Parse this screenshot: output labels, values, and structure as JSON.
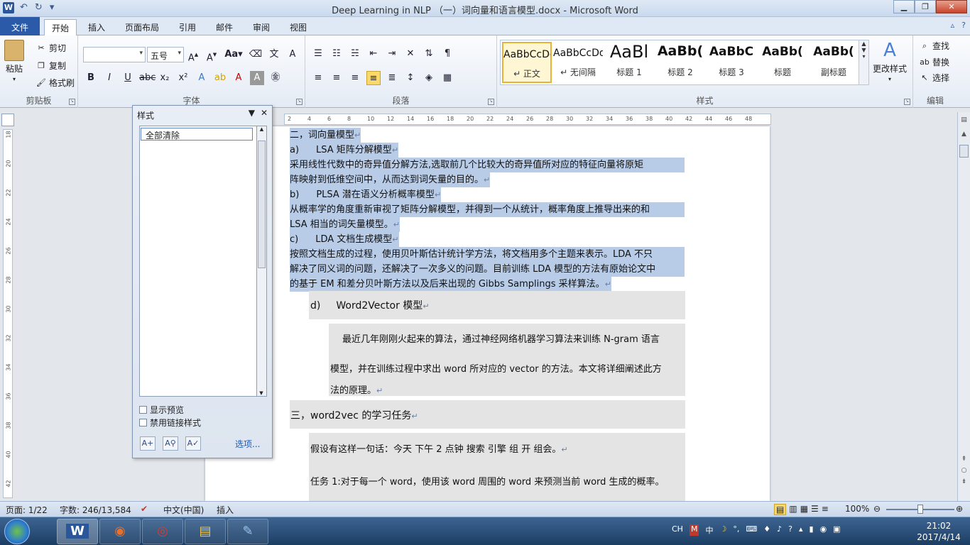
{
  "window": {
    "title": "Deep Learning in NLP （一）词向量和语言模型.docx - Microsoft Word",
    "app_badge": "W",
    "qat_icons": [
      "undo-icon",
      "redo-icon",
      "customize-icon"
    ]
  },
  "tabs": {
    "file": "文件",
    "items": [
      "开始",
      "插入",
      "页面布局",
      "引用",
      "邮件",
      "审阅",
      "视图"
    ],
    "active": "开始"
  },
  "ribbon": {
    "clipboard": {
      "label": "剪贴板",
      "paste": "粘贴",
      "cut": "剪切",
      "copy": "复制",
      "format_painter": "格式刷"
    },
    "font": {
      "label": "字体",
      "font_name": "",
      "font_size": "五号",
      "change_case": "Aa"
    },
    "paragraph": {
      "label": "段落"
    },
    "styles": {
      "label": "样式",
      "items": [
        {
          "sample": "AaBbCcDd",
          "name": "↵ 正文"
        },
        {
          "sample": "AaBbCcDd",
          "name": "↵ 无间隔"
        },
        {
          "sample": "AaBl",
          "name": "标题 1"
        },
        {
          "sample": "AaBb(",
          "name": "标题 2"
        },
        {
          "sample": "AaBbC",
          "name": "标题 3"
        },
        {
          "sample": "AaBb(",
          "name": "标题"
        },
        {
          "sample": "AaBb(",
          "name": "副标题"
        }
      ],
      "change_styles": "更改样式"
    },
    "editing": {
      "label": "编辑",
      "find": "查找",
      "replace": "替换",
      "select": "选择"
    }
  },
  "ruler": {
    "h_ticks": [
      "2",
      "4",
      "6",
      "8",
      "10",
      "12",
      "14",
      "16",
      "18",
      "20",
      "22",
      "24",
      "26",
      "28",
      "30",
      "32",
      "34",
      "36",
      "38",
      "40",
      "42",
      "44",
      "46",
      "48"
    ],
    "v_ticks": [
      "18",
      "20",
      "22",
      "24",
      "26",
      "28",
      "30",
      "32",
      "34",
      "36",
      "38",
      "40",
      "42"
    ]
  },
  "styles_pane": {
    "title": "样式",
    "list_item": "全部清除",
    "show_preview": "显示预览",
    "disable_linked": "禁用链接样式",
    "options": "选项..."
  },
  "document": {
    "h2": "二，词向量模型",
    "a_label": "a)",
    "a_title": "LSA 矩阵分解模型",
    "a_body1": "  采用线性代数中的奇异值分解方法,选取前几个比较大的奇异值所对应的特征向量将原矩",
    "a_body2": "阵映射到低维空间中，从而达到词矢量的目的。",
    "b_label": "b)",
    "b_title": "PLSA 潜在语义分析概率模型",
    "b_body1": "  从概率学的角度重新审视了矩阵分解模型，并得到一个从统计，概率角度上推导出来的和",
    "b_body2": "LSA 相当的词矢量模型。",
    "c_label": "c)",
    "c_title": "LDA 文档生成模型",
    "c_body1": "  按照文档生成的过程，使用贝叶斯估计统计学方法，将文档用多个主题来表示。LDA 不只",
    "c_body2": "解决了同义词的问题，还解决了一次多义的问题。目前训练 LDA 模型的方法有原始论文中",
    "c_body3": "的基于 EM 和差分贝叶斯方法以及后来出现的 Gibbs Samplings 采样算法。",
    "d_label": "d)",
    "d_title": "Word2Vector 模型",
    "d_body1": "最近几年刚刚火起来的算法，通过神经网络机器学习算法来训练 N-gram 语言",
    "d_body2": "模型，并在训练过程中求出 word 所对应的 vector 的方法。本文将详细阐述此方",
    "d_body3": "法的原理。",
    "h3": "三，word2vec 的学习任务",
    "t_body1": "假设有这样一句话：今天 下午 2 点钟 搜索 引擎 组 开 组会。",
    "t_body2": "任务 1:对于每一个 word，使用该 word 周围的 word 来预测当前 word 生成的概率。",
    "para_mark": "↵"
  },
  "status": {
    "page": "页面: 1/22",
    "words": "字数: 246/13,584",
    "language": "中文(中国)",
    "mode": "插入",
    "zoom": "100%"
  },
  "taskbar": {
    "apps": [
      {
        "name": "word",
        "label": "W",
        "color": "#2b579a"
      },
      {
        "name": "firefox",
        "label": "◉",
        "color": "#e8702a"
      },
      {
        "name": "chrome",
        "label": "◎",
        "color": "#d93b2e"
      },
      {
        "name": "explorer",
        "label": "▤",
        "color": "#e8c45a"
      },
      {
        "name": "paint",
        "label": "✎",
        "color": "#9ac4ee"
      }
    ],
    "tray": [
      "CH",
      "M",
      "中",
      "☽",
      "°,",
      "⌨",
      "♦",
      "♪",
      "?",
      "▴",
      "▮",
      "◉",
      "▣"
    ],
    "time": "21:02",
    "date": "2017/4/14"
  },
  "colors": {
    "selection": "#b8cce8",
    "file_tab": "#2a5aa8",
    "grey_block": "#e4e4e4"
  }
}
